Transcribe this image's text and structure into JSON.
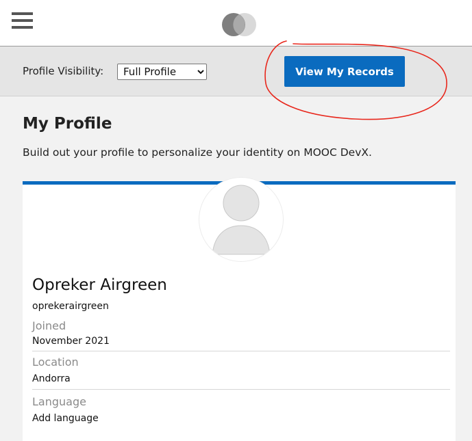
{
  "header": {
    "menu_icon": "hamburger-menu-icon",
    "logo_icon": "overlapping-circles-logo"
  },
  "visibility": {
    "label": "Profile Visibility:",
    "selected": "Full Profile"
  },
  "records_button": {
    "label": "View My Records",
    "color": "#0a6bbf"
  },
  "page": {
    "title": "My Profile",
    "subtitle": "Build out your profile to personalize your identity on MOOC DevX."
  },
  "profile": {
    "name": "Opreker Airgreen",
    "username": "oprekerairgreen",
    "avatar_icon": "default-user-avatar",
    "joined_label": "Joined",
    "joined_value": "November 2021",
    "location_label": "Location",
    "location_value": "Andorra",
    "language_label": "Language",
    "language_value": "Add language"
  },
  "colors": {
    "accent": "#0a6bbf",
    "annotation": "#e8271c"
  }
}
